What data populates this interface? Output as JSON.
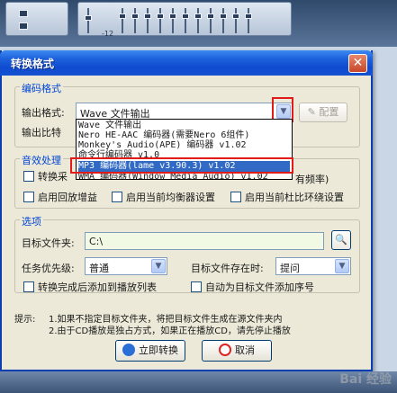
{
  "background": {
    "eq_label": "-12"
  },
  "dialog": {
    "title": "转换格式",
    "close_glyph": "✕",
    "encoding_group": {
      "title": "编码格式",
      "output_format_label": "输出格式:",
      "output_format_value": "Wave 文件输出",
      "config_button": "配置",
      "bitrate_label": "输出比特"
    },
    "dropdown": {
      "options": [
        "Wave 文件输出",
        "Nero HE-AAC 编码器(需要Nero 6组件)",
        "Monkey's Audio(APE) 编码器 v1.02",
        "命令行编码器 v1.0",
        "MP3 编码器(lame v3.90.3) v1.02",
        "WMA 编码器(Window Media Audio) v1.02"
      ],
      "selected_index": 4
    },
    "audio_group": {
      "title": "音效处理",
      "check1": "转换采",
      "check1_tail": "有频率)",
      "check2": "启用回放增益",
      "check3": "启用当前均衡器设置",
      "check4": "启用当前杜比环绕设置"
    },
    "options_group": {
      "title": "选项",
      "target_folder_label": "目标文件夹:",
      "target_folder_value": "C:\\",
      "priority_label": "任务优先级:",
      "priority_value": "普通",
      "exists_label": "目标文件存在时:",
      "exists_value": "提问",
      "check_add_playlist": "转换完成后添加到播放列表",
      "check_add_seq": "自动为目标文件添加序号"
    },
    "hint": {
      "prefix": "提示:",
      "line1": "1.如果不指定目标文件夹，将把目标文件生成在源文件夹内",
      "line2": "2.由于CD播放是独占方式，如果正在播放CD，请先停止播放"
    },
    "convert_button": "立即转换",
    "cancel_button": "取消"
  },
  "watermark": "Bai 经验",
  "colors": {
    "titlebar": "#0f4bcf",
    "selection": "#316ac5",
    "highlight_box": "#e21a1a",
    "group_title": "#0046d5"
  }
}
